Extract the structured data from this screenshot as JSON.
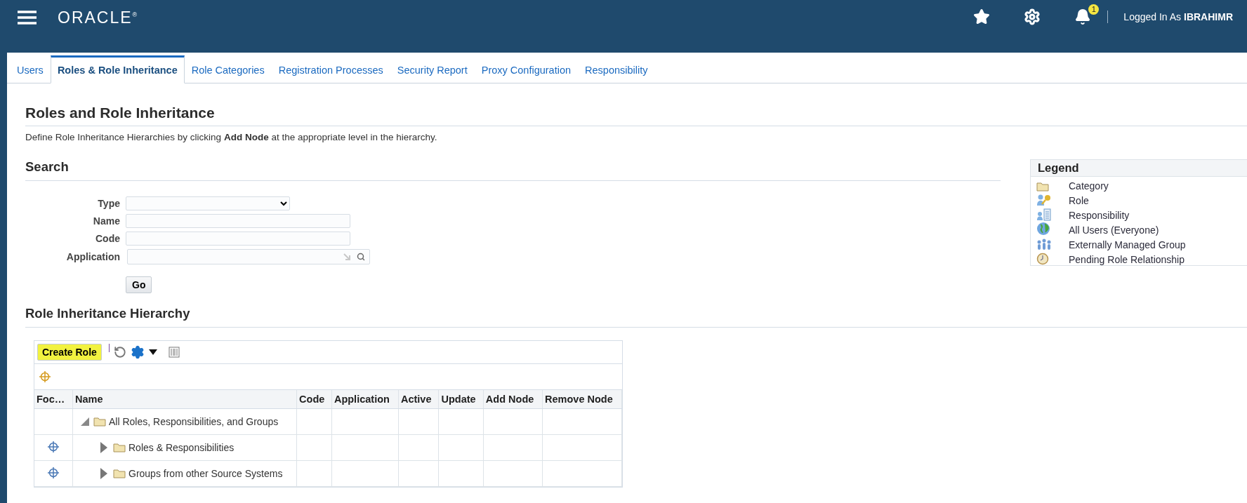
{
  "header": {
    "logo": "ORACLE$^{®}$",
    "notification_count": "1",
    "logged_in": "Logged In As **IBRAHIMR**"
  },
  "tabs": [
    {
      "label": "Users",
      "selected": false
    },
    {
      "label": "Roles & Role Inheritance",
      "selected": true
    },
    {
      "label": "Role Categories",
      "selected": false
    },
    {
      "label": "Registration Processes",
      "selected": false
    },
    {
      "label": "Security Report",
      "selected": false
    },
    {
      "label": "Proxy Configuration",
      "selected": false
    },
    {
      "label": "Responsibility",
      "selected": false
    }
  ],
  "page": {
    "title": "Roles and Role Inheritance",
    "description": "Define Role Inheritance Hierarchies by clicking **Add Node** at the appropriate level in the hierarchy."
  },
  "search": {
    "title": "Search",
    "fields": [
      {
        "label": "Type",
        "kind": "select"
      },
      {
        "label": "Name",
        "kind": "text"
      },
      {
        "label": "Code",
        "kind": "text"
      },
      {
        "label": "Application",
        "kind": "lookup"
      }
    ],
    "go_button": "Go"
  },
  "legend": {
    "title": "Legend",
    "items": [
      {
        "label": "Category",
        "kind": "folder"
      },
      {
        "label": "Role",
        "kind": "role"
      },
      {
        "label": "Responsibility",
        "kind": "responsibility"
      },
      {
        "label": "All Users (Everyone)",
        "kind": "globe"
      },
      {
        "label": "Externally Managed Group",
        "kind": "group"
      },
      {
        "label": "Pending Role Relationship",
        "kind": "pending"
      }
    ]
  },
  "hierarchy": {
    "title": "Role Inheritance Hierarchy",
    "create_button": {
      "label": "Create Role",
      "highlighted": true
    },
    "columns": [
      "Foc…",
      "Name",
      "Code",
      "Application",
      "Active",
      "Update",
      "Add Node",
      "Remove Node"
    ],
    "rows": [
      {
        "name": "All Roles, Responsibilities, and Groups",
        "focusable": false,
        "expanded": true,
        "children": [
          {
            "name": "Roles & Responsibilities",
            "focusable": true,
            "expanded": false
          },
          {
            "name": "Groups from other Source Systems",
            "focusable": true,
            "expanded": false
          }
        ]
      }
    ]
  }
}
